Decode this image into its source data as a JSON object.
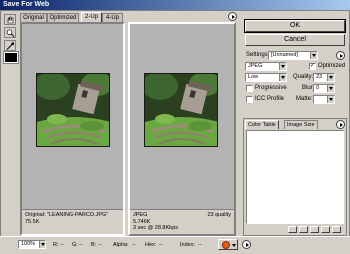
{
  "window": {
    "title": "Save For Web"
  },
  "tabs": [
    {
      "label": "Original"
    },
    {
      "label": "Optimized"
    },
    {
      "label": "2-Up"
    },
    {
      "label": "4-Up"
    }
  ],
  "active_tab": "2-Up",
  "panes": {
    "left": {
      "filename": "Original: \"LEANING-PARCO.JPG\"",
      "size": "75.5K"
    },
    "right": {
      "format": "JPEG",
      "size": "5.746K",
      "time": "3 sec @ 28.8Kbps",
      "quality": "23 quality"
    }
  },
  "buttons": {
    "ok": "OK",
    "cancel": "Cancel"
  },
  "settings": {
    "settings_label": "Settings:",
    "preset": "[Unnamed]",
    "format": "JPEG",
    "optimized_label": "Optimized",
    "optimized_checked": true,
    "quality_level": "Low",
    "quality_label": "Quality:",
    "quality_value": "23",
    "progressive_label": "Progressive",
    "progressive_checked": false,
    "blur_label": "Blur:",
    "blur_value": "0",
    "icc_label": "ICC Profile",
    "icc_checked": false,
    "matte_label": "Matte:",
    "matte_value": ""
  },
  "panel_tabs": [
    {
      "label": "Color Table"
    },
    {
      "label": "Image Size"
    }
  ],
  "status": {
    "zoom": "100%",
    "r": "R:",
    "g": "G:",
    "b": "B:",
    "alpha": "Alpha:",
    "hex": "Hex:",
    "index": "Index:",
    "r_value": "--",
    "g_value": "--",
    "b_value": "--",
    "alpha_value": "--",
    "hex_value": "--",
    "index_value": "--"
  },
  "icons": [
    "hand-icon",
    "zoom-icon",
    "eyedropper-icon",
    "eyedropper-color-swatch",
    "panel-menu-icon",
    "browser-preview-icon"
  ],
  "colors": {
    "title_start": "#0a246a",
    "title_end": "#a6caf0",
    "canvas": "#b3b3b3",
    "chrome": "#d4d0c8"
  }
}
